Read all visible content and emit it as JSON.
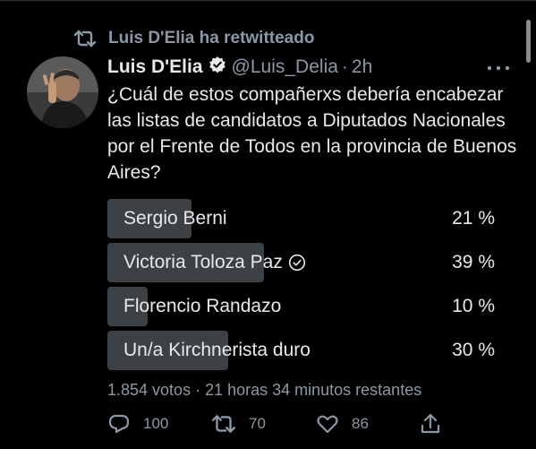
{
  "retweet_banner": {
    "text": "Luis D'Elia ha retwitteado",
    "icon": "retweet-icon"
  },
  "tweet": {
    "author_name": "Luis D'Elia",
    "verified": true,
    "handle": "@Luis_Delia",
    "separator": "·",
    "time": "2h",
    "text": "¿Cuál de estos compañerxs debería encabezar las listas de candidatos a Diputados Nacionales por el Frente de Todos en la provincia de Buenos Aires?",
    "poll": {
      "options": [
        {
          "label": "Sergio Berni",
          "percent_label": "21 %",
          "percent": 21,
          "selected": false
        },
        {
          "label": "Victoria Toloza Paz",
          "percent_label": "39 %",
          "percent": 39,
          "selected": true
        },
        {
          "label": "Florencio Randazo",
          "percent_label": "10 %",
          "percent": 10,
          "selected": false
        },
        {
          "label": "Un/a Kirchnerista duro",
          "percent_label": "30 %",
          "percent": 30,
          "selected": false
        }
      ],
      "meta": "1.854 votos · 21 horas 34 minutos restantes"
    },
    "actions": {
      "reply_count": "100",
      "retweet_count": "70",
      "like_count": "86"
    }
  },
  "colors": {
    "background": "#000000",
    "text": "#e7e9ea",
    "secondary": "#8b98a5",
    "poll_bar": "#3c4145"
  }
}
